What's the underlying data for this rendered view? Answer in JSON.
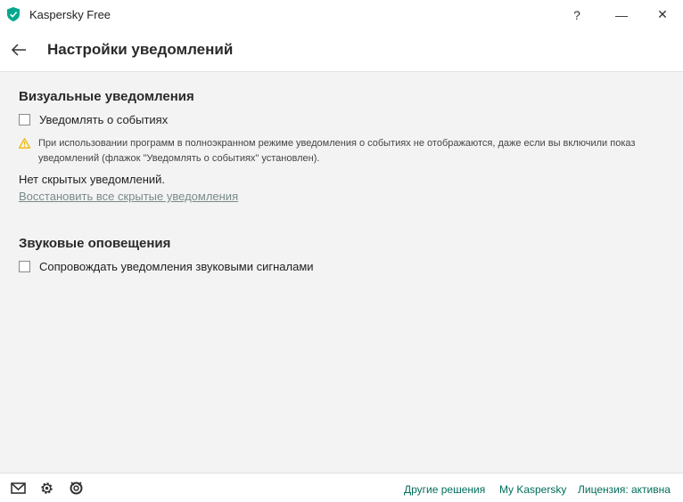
{
  "window": {
    "title": "Kaspersky Free",
    "help_glyph": "?",
    "minimize_glyph": "—",
    "close_glyph": "✕"
  },
  "header": {
    "title": "Настройки уведомлений"
  },
  "visual": {
    "title": "Визуальные уведомления",
    "notify_checkbox_label": "Уведомлять о событиях",
    "notify_checked": false,
    "warning_text": "При использовании программ в полноэкранном режиме уведомления о событиях не отображаются, даже если вы включили показ уведомлений (флажок \"Уведомлять о событиях\" установлен).",
    "no_hidden_text": "Нет скрытых уведомлений.",
    "restore_link": "Восстановить все скрытые уведомления"
  },
  "sound": {
    "title": "Звуковые оповещения",
    "sound_checkbox_label": "Сопровождать уведомления звуковыми сигналами",
    "sound_checked": false
  },
  "footer": {
    "icons": [
      "mail-icon",
      "gear-icon",
      "support-icon"
    ],
    "links": [
      "Другие решения",
      "My Kaspersky",
      "Лицензия: активна"
    ]
  },
  "colors": {
    "brand_green": "#00a88e",
    "link_green": "#006d5b",
    "warning_yellow": "#f2b600",
    "content_bg": "#f3f3f3"
  }
}
